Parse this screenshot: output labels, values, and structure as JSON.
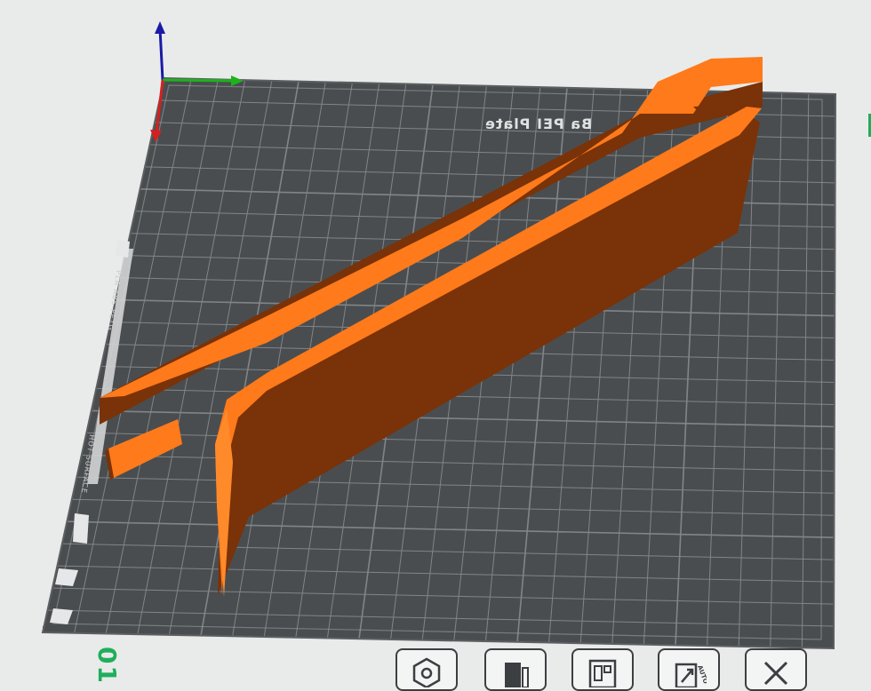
{
  "viewport": {
    "plate_label": "Ba      PEI Plate",
    "plate_side_text_1": "PLA ABS PETG",
    "plate_side_text_2": "HOT SURFACE",
    "plate_number": "01",
    "colors": {
      "background": "#e9ebea",
      "plate": "#4a4d4f",
      "grid": "#8c8f91",
      "model_top": "#ff7a1a",
      "model_side": "#7a3208",
      "axis_x": "#1db31d",
      "axis_y": "#d42020",
      "axis_z": "#1a1aa8",
      "accent": "#1fae5c"
    }
  },
  "toolbar": {
    "buttons": [
      {
        "name": "orient-button",
        "icon": "hexagon-icon"
      },
      {
        "name": "arrange-button",
        "icon": "bed-icon"
      },
      {
        "name": "layout-button",
        "icon": "grid-layout-icon"
      },
      {
        "name": "auto-orient-button",
        "icon": "auto-orient-icon",
        "label": "AUTO"
      },
      {
        "name": "close-plate-button",
        "icon": "close-icon"
      }
    ]
  }
}
